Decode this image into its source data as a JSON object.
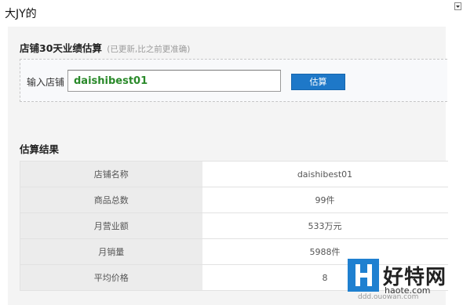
{
  "page": {
    "title": "大JY的"
  },
  "estimate": {
    "title": "店铺30天业绩估算",
    "note": "(已更新,比之前更准确)",
    "input_label": "输入店铺",
    "input_value": "daishibest01",
    "button_label": "估算"
  },
  "results": {
    "title": "估算结果",
    "rows": [
      {
        "label": "店铺名称",
        "value": "daishibest01"
      },
      {
        "label": "商品总数",
        "value": "99件"
      },
      {
        "label": "月营业额",
        "value": "533万元"
      },
      {
        "label": "月销量",
        "value": "5988件"
      },
      {
        "label": "平均价格",
        "value": "8"
      }
    ]
  },
  "watermark": {
    "brand": "好特网",
    "domain": "haote.com",
    "domain2": "ddd.ouowan.com",
    "icon": "h-logo-icon",
    "color": "#1f80d0"
  },
  "colors": {
    "button": "#1e78c8",
    "input_text": "#2a8a2a"
  }
}
